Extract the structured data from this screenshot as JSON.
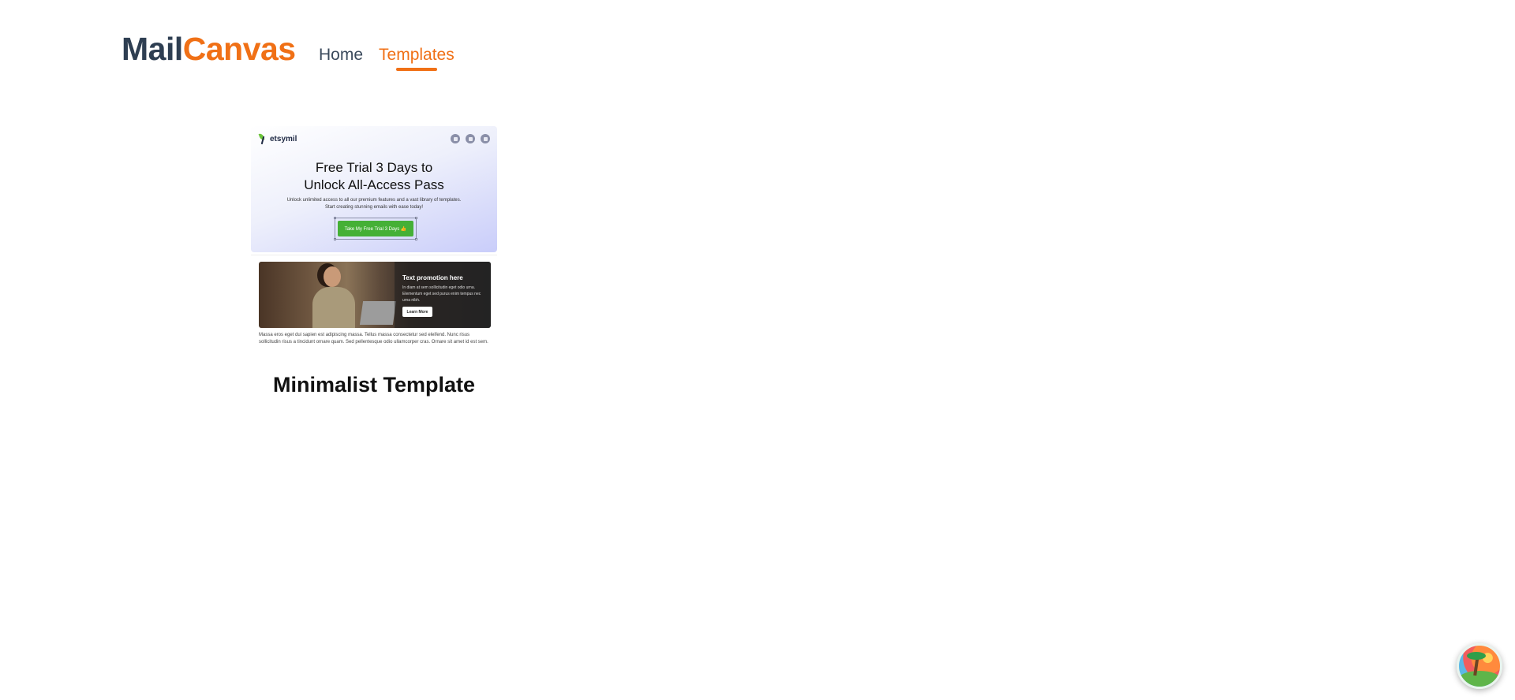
{
  "header": {
    "logo": {
      "part1": "Mail",
      "part2": "Canvas"
    },
    "nav": [
      {
        "label": "Home",
        "active": false
      },
      {
        "label": "Templates",
        "active": true
      }
    ],
    "colors": {
      "brand_dark": "#2e3e52",
      "accent": "#f07016"
    }
  },
  "templates": [
    {
      "title": "Minimalist Template",
      "preview": {
        "brand_name": "etsymil",
        "hero_title_line1": "Free Trial 3 Days to",
        "hero_title_line2": "Unlock All-Access Pass",
        "hero_sub_line1": "Unlock unlimited access to all our premium features and a vast library of templates.",
        "hero_sub_line2": "Start creating stunning emails with ease today!",
        "cta_label": "Take My Free Trial 3 Days 👍",
        "promo_title": "Text promotion here",
        "promo_text": "In diam at sem sollicitudin eget odio urna. Elementum eget sed purus enim tempus nec urna nibh.",
        "promo_button": "Learn More",
        "body_text": "Massa eros eget dui sapien est adipiscing massa. Tellus massa consectetur sed eleifend. Nunc risus sollicitudin risus a tincidunt ornare quam. Sed pellentesque odio ullamcorper cras. Ornare sit amet id est sem."
      }
    }
  ]
}
